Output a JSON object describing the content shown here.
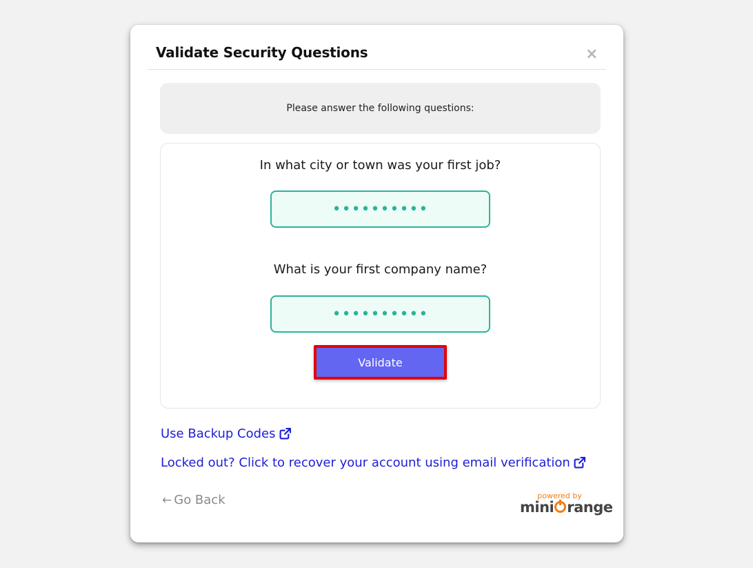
{
  "dialog": {
    "title": "Validate Security Questions",
    "close_glyph": "×",
    "instructions": "Please answer the following questions:"
  },
  "questions": [
    {
      "label": "In what city or town was your first job?",
      "answer_masked": "••••••••••"
    },
    {
      "label": "What is your first company name?",
      "answer_masked": "••••••••••"
    }
  ],
  "validate_button": {
    "label": "Validate"
  },
  "links": {
    "backup_codes": "Use Backup Codes",
    "recover": "Locked out? Click to recover your account using email verification"
  },
  "go_back": {
    "arrow": "←",
    "label": "Go Back"
  },
  "branding": {
    "powered_by": "powered by",
    "logo_prefix": "mini",
    "logo_suffix": "range"
  },
  "colors": {
    "accent": "#6366f1",
    "highlight_border": "#e30000",
    "input_border": "#2bb39a",
    "input_bg": "#eefcf7",
    "link": "#1d1dd6",
    "brand_orange": "#f07c18"
  },
  "icons": {
    "external_link": "external-link-icon",
    "close": "close-icon",
    "back_arrow": "arrow-left-icon"
  }
}
